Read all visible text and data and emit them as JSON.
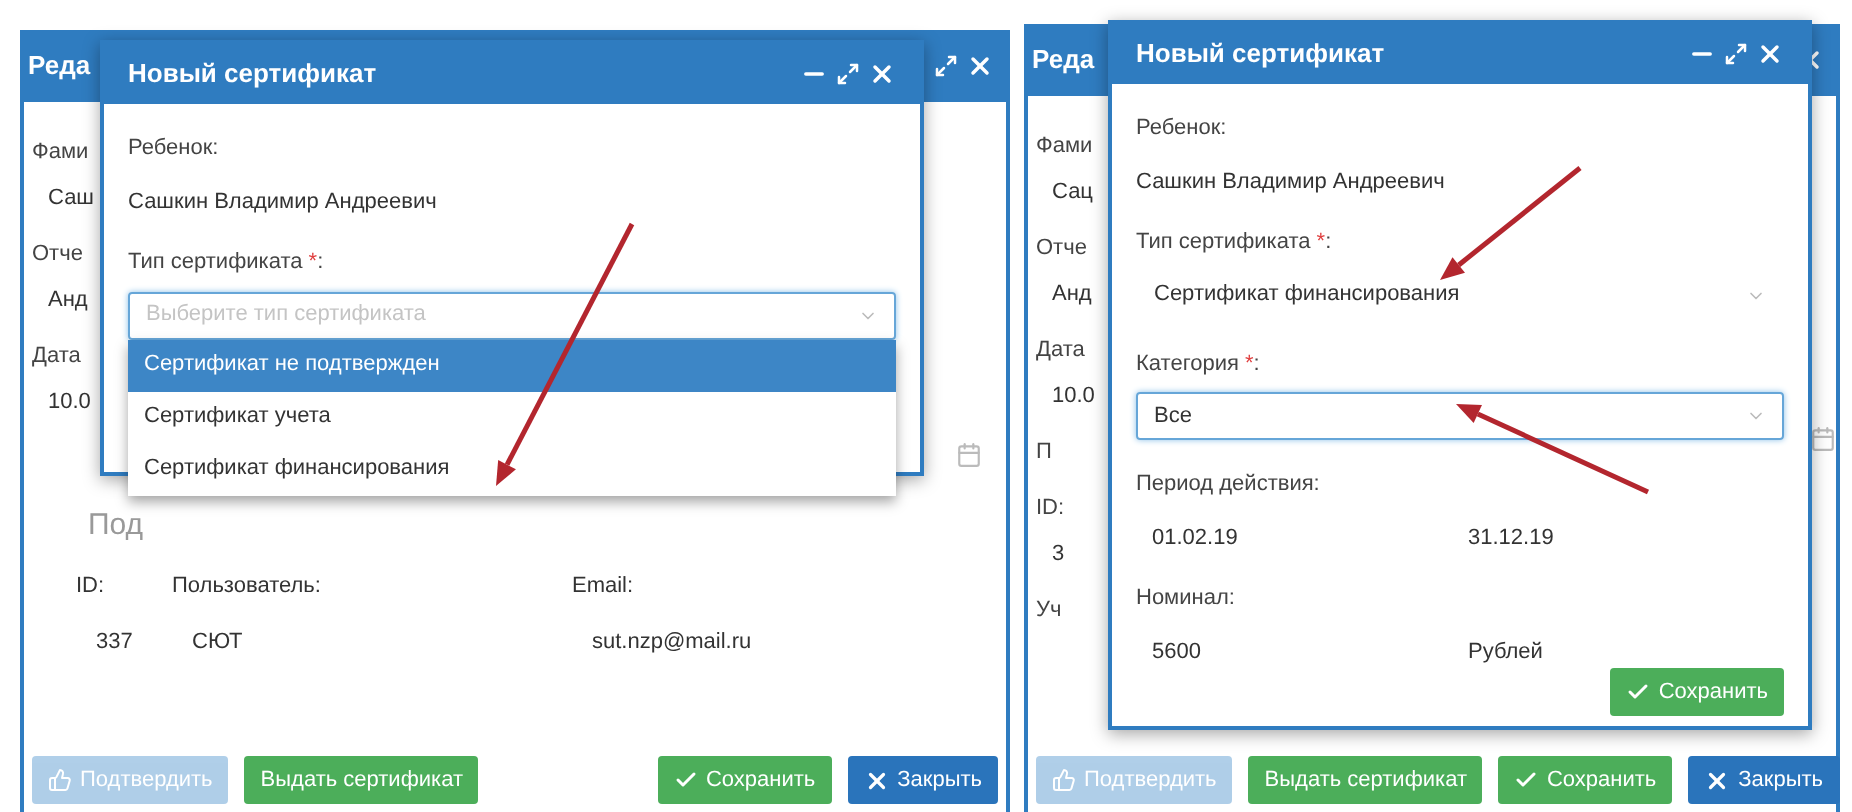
{
  "panels": [
    {
      "back_window": {
        "title": "Реда",
        "fragments": [
          {
            "kind": "label",
            "text": "Фами"
          },
          {
            "kind": "value",
            "text": "Саш"
          },
          {
            "kind": "label",
            "text": "Отче"
          },
          {
            "kind": "value",
            "text": "Анд"
          },
          {
            "kind": "label",
            "text": "Дата"
          },
          {
            "kind": "value",
            "text": "10.0"
          }
        ],
        "legend": "Под",
        "table": {
          "columns": [
            "ID:",
            "Пользователь:",
            "Email:"
          ],
          "rows": [
            [
              "337",
              "СЮТ",
              "sut.nzp@mail.ru"
            ]
          ]
        },
        "buttons": [
          {
            "kind": "confirm",
            "label": "Подтвердить",
            "disabled": true
          },
          {
            "kind": "issue",
            "label": "Выдать сертификат",
            "disabled": false
          },
          {
            "kind": "save",
            "label": "Сохранить",
            "disabled": false
          },
          {
            "kind": "close",
            "label": "Закрыть",
            "disabled": false
          }
        ]
      },
      "modal": {
        "title": "Новый сертификат",
        "fields": [
          {
            "kind": "label",
            "text": "Ребенок:"
          },
          {
            "kind": "text",
            "text": "Сашкин Владимир Андреевич"
          },
          {
            "kind": "label",
            "text": "Тип сертификата ",
            "mark": "*",
            "end": ":"
          },
          {
            "kind": "select",
            "placeholder": "Выберите тип сертификата",
            "focused": true,
            "open": true,
            "options": [
              {
                "label": "Сертификат не подтвержден",
                "selected": true
              },
              {
                "label": "Сертификат учета",
                "selected": false
              },
              {
                "label": "Сертификат финансирования",
                "selected": false
              }
            ]
          }
        ]
      }
    },
    {
      "back_window": {
        "title": "Реда",
        "fragments": [
          {
            "kind": "label",
            "text": "Фами"
          },
          {
            "kind": "value",
            "text": "Сац"
          },
          {
            "kind": "label",
            "text": "Отче"
          },
          {
            "kind": "value",
            "text": "Анд"
          },
          {
            "kind": "label",
            "text": "Дата"
          },
          {
            "kind": "value",
            "text": "10.0"
          },
          {
            "kind": "label",
            "text": "П"
          },
          {
            "kind": "label",
            "text": "ID:"
          },
          {
            "kind": "value",
            "text": "3"
          },
          {
            "kind": "label",
            "text": "Уч"
          }
        ],
        "buttons": [
          {
            "kind": "confirm",
            "label": "Подтвердить",
            "disabled": true
          },
          {
            "kind": "issue",
            "label": "Выдать сертификат",
            "disabled": false
          },
          {
            "kind": "save",
            "label": "Сохранить",
            "disabled": false
          },
          {
            "kind": "close",
            "label": "Закрыть",
            "disabled": false
          }
        ]
      },
      "modal": {
        "title": "Новый сертификат",
        "fields": [
          {
            "kind": "label",
            "text": "Ребенок:"
          },
          {
            "kind": "text",
            "text": "Сашкин Владимир Андреевич"
          },
          {
            "kind": "label",
            "text": "Тип сертификата ",
            "mark": "*",
            "end": ":"
          },
          {
            "kind": "select",
            "value": "Сертификат финансирования",
            "focused": false
          },
          {
            "kind": "label",
            "text": "Категория ",
            "mark": "*",
            "end": ":"
          },
          {
            "kind": "select",
            "value": "Все",
            "focused": true
          },
          {
            "kind": "label",
            "text": "Период действия:"
          },
          {
            "kind": "pair",
            "values": [
              "01.02.19",
              "31.12.19"
            ]
          },
          {
            "kind": "label",
            "text": "Номинал:"
          },
          {
            "kind": "pair",
            "values": [
              "5600",
              "Рублей"
            ]
          }
        ],
        "button": {
          "kind": "save",
          "label": "Сохранить",
          "disabled": false
        }
      }
    }
  ]
}
